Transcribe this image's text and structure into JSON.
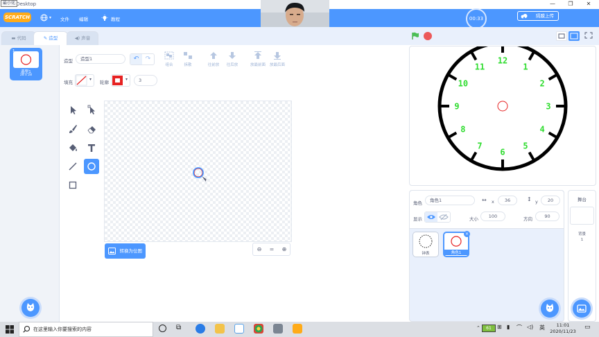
{
  "window": {
    "title": "Scratch Desktop",
    "title_visible": "tch Desktop",
    "minimize_tooltip": "最小化",
    "buttons": [
      "—",
      "❐",
      "✕"
    ]
  },
  "menubar": {
    "logo": "SCRATCH",
    "items": [
      "文件",
      "编辑",
      "教程"
    ],
    "timer": "00:33",
    "upload": "隔膜上传"
  },
  "tabs": [
    {
      "label": "代码",
      "icon": "code-icon"
    },
    {
      "label": "造型",
      "icon": "brush-icon",
      "active": true
    },
    {
      "label": "声音",
      "icon": "speaker-icon"
    }
  ],
  "costume_list": {
    "items": [
      {
        "index": "1",
        "name": "造型1",
        "size": "28 x 28"
      }
    ]
  },
  "editor": {
    "costume_label": "造型",
    "costume_name": "造型1",
    "fill_label": "填充",
    "outline_label": "轮廓",
    "outline_width": "3",
    "actions": [
      "组合",
      "拆散",
      "往前放",
      "往后放",
      "放最前面",
      "放最后面"
    ],
    "convert_button": "转换为位图",
    "zoom_reset": "="
  },
  "sprite_info": {
    "sprite_label": "角色",
    "sprite_name": "角色1",
    "x_label": "x",
    "x_value": "36",
    "y_label": "y",
    "y_value": "20",
    "show_label": "显示",
    "size_label": "大小",
    "size_value": "100",
    "direction_label": "方向",
    "direction_value": "90"
  },
  "sprites": [
    {
      "name": "钟表"
    },
    {
      "name": "角色1",
      "selected": true
    }
  ],
  "stage_panel": {
    "title": "舞台",
    "backdrop_label": "背景",
    "backdrop_count": "1"
  },
  "clock": {
    "numbers": [
      "12",
      "1",
      "2",
      "3",
      "4",
      "5",
      "6",
      "7",
      "8",
      "9",
      "10",
      "11"
    ],
    "number_color": "#2fdc2f",
    "tick_color": "#000000"
  },
  "taskbar": {
    "search_placeholder": "在这里输入你要搜索的内容",
    "battery": "61",
    "ime": "英",
    "time": "11:01",
    "date": "2020/11/23"
  },
  "colors": {
    "accent": "#4c97ff",
    "outline": "#e62222",
    "logo": "#ffab19"
  }
}
